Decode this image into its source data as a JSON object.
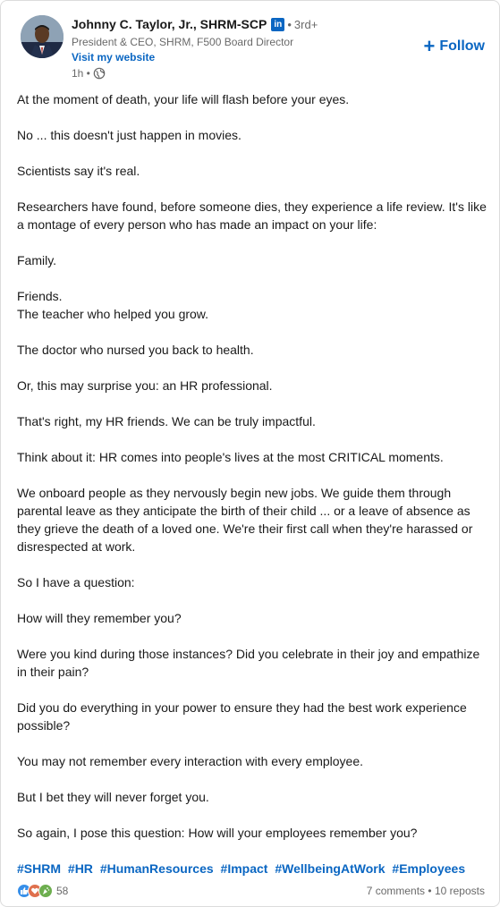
{
  "author": {
    "name": "Johnny C. Taylor, Jr., SHRM-SCP",
    "badge": "in",
    "separator": "•",
    "degree": "3rd+",
    "headline": "President & CEO, SHRM, F500 Board Director",
    "website_label": "Visit my website",
    "time": "1h •",
    "visibility_icon": "globe-icon"
  },
  "follow": {
    "icon": "+",
    "label": "Follow"
  },
  "post": {
    "paragraphs": [
      "At the moment of death, your life will flash before your eyes.",
      "No ... this doesn't just happen in movies.",
      "Scientists say it's real.",
      "Researchers have found, before someone dies, they experience a life review. It's like a montage of every person who has made an impact on your life:",
      "Family.",
      "Friends.",
      "The teacher who helped you grow.",
      "The doctor who nursed you back to health.",
      "Or, this may surprise you: an HR professional.",
      "That's right, my HR friends. We can be truly impactful.",
      "Think about it: HR comes into people's lives at the most CRITICAL moments.",
      "We onboard people as they nervously begin new jobs. We guide them through parental leave as they anticipate the birth of their child ... or a leave of absence as they grieve the death of a loved one. We're their first call when they're harassed or disrespected at work.",
      "So I have a question:",
      "How will they remember you?",
      "Were you kind during those instances? Did you celebrate in their joy and empathize in their pain?",
      "Did you do everything in your power to ensure they had the best work experience possible?",
      "You may not remember every interaction with every employee.",
      "But I bet they will never forget you.",
      "So again, I pose this question: How will your employees remember you?"
    ],
    "hashtags": [
      "#SHRM",
      "#HR",
      "#HumanResources",
      "#Impact",
      "#WellbeingAtWork",
      "#Employees"
    ]
  },
  "social": {
    "reaction_icons": [
      "like-icon",
      "love-icon",
      "celebrate-icon"
    ],
    "reaction_count": "58",
    "comments": "7 comments",
    "separator": "•",
    "reposts": "10 reposts"
  },
  "colors": {
    "brand_blue": "#0a66c2",
    "like": "#378fe9",
    "love": "#df704d",
    "celebrate": "#6dae4f"
  }
}
